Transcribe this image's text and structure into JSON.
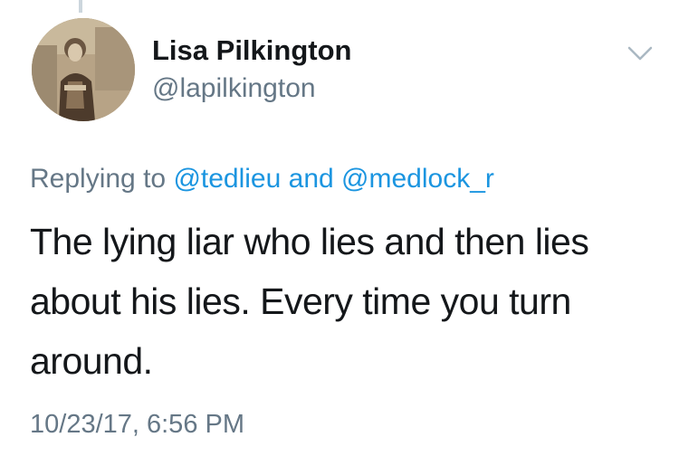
{
  "tweet": {
    "author": {
      "display_name": "Lisa Pilkington",
      "handle": "@lapilkington"
    },
    "reply": {
      "prefix": "Replying to",
      "mention_1": "@tedlieu",
      "conjunction": "and",
      "mention_2": "@medlock_r"
    },
    "text": "The lying liar who lies and then lies about his lies. Every time you turn around.",
    "timestamp": "10/23/17, 6:56 PM",
    "menu_icon": "chevron-down-icon"
  },
  "colors": {
    "primary_text": "#14171a",
    "secondary_text": "#657786",
    "link": "#1b95e0",
    "caret": "#aab8c2",
    "thread_line": "#ccd6dd"
  }
}
